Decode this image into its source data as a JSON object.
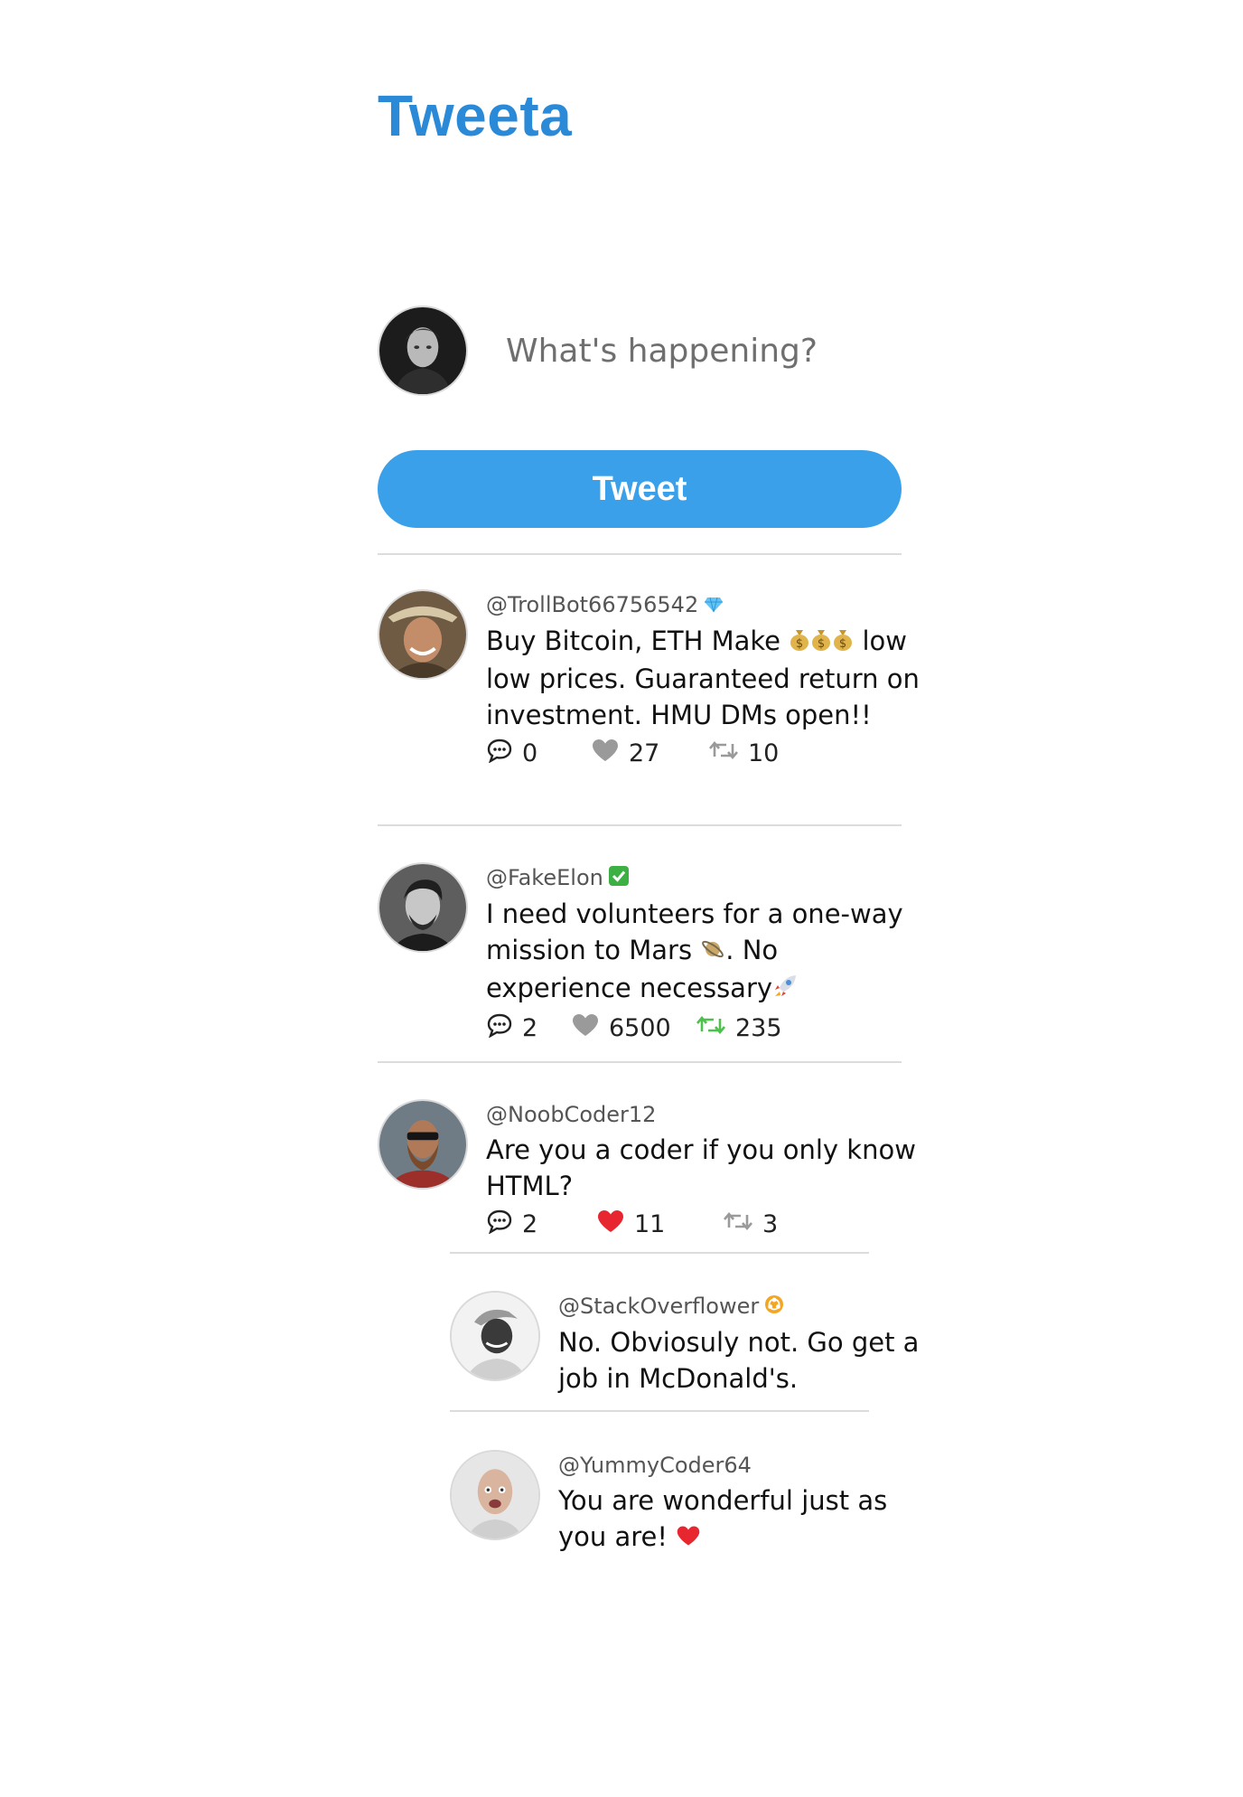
{
  "app": {
    "title": "Tweeta"
  },
  "composer": {
    "placeholder": "What's happening?",
    "avatar": "user-avatar",
    "button_label": "Tweet"
  },
  "colors": {
    "brand": "#2b8ad8",
    "button": "#3aa0ea",
    "liked": "#e8262f",
    "retweeted": "#4cc14c",
    "muted_icon": "#9a9a9a"
  },
  "feed": [
    {
      "handle": "@TrollBot66756542",
      "badge": "gem-icon",
      "text_parts": [
        "Buy Bitcoin, ETH Make",
        "low low prices. Guaranteed return on investment. HMU DMs open!!"
      ],
      "inline_emoji": "money-bag-icon x3",
      "comments": "0",
      "likes": "27",
      "retweets": "10",
      "liked": false,
      "retweeted": false
    },
    {
      "handle": "@FakeElon",
      "badge": "check-mark-icon",
      "text_parts": [
        "I need volunteers for a one-way mission to Mars",
        ". No experience necessary"
      ],
      "inline_emoji": "planet-icon, rocket-icon",
      "comments": "2",
      "likes": "6500",
      "retweets": "235",
      "liked": false,
      "retweeted": true
    },
    {
      "handle": "@NoobCoder12",
      "text": "Are you a coder if you only know HTML?",
      "comments": "2",
      "likes": "11",
      "retweets": "3",
      "liked": true,
      "retweeted": false,
      "replies": [
        {
          "handle": "@StackOverflower",
          "badge": "biohazard-icon",
          "text": "No. Obviosuly not. Go get a job in McDonald's."
        },
        {
          "handle": "@YummyCoder64",
          "text_parts": [
            "You are wonderful just as you are!"
          ],
          "inline_emoji": "red-heart-icon"
        }
      ]
    }
  ]
}
